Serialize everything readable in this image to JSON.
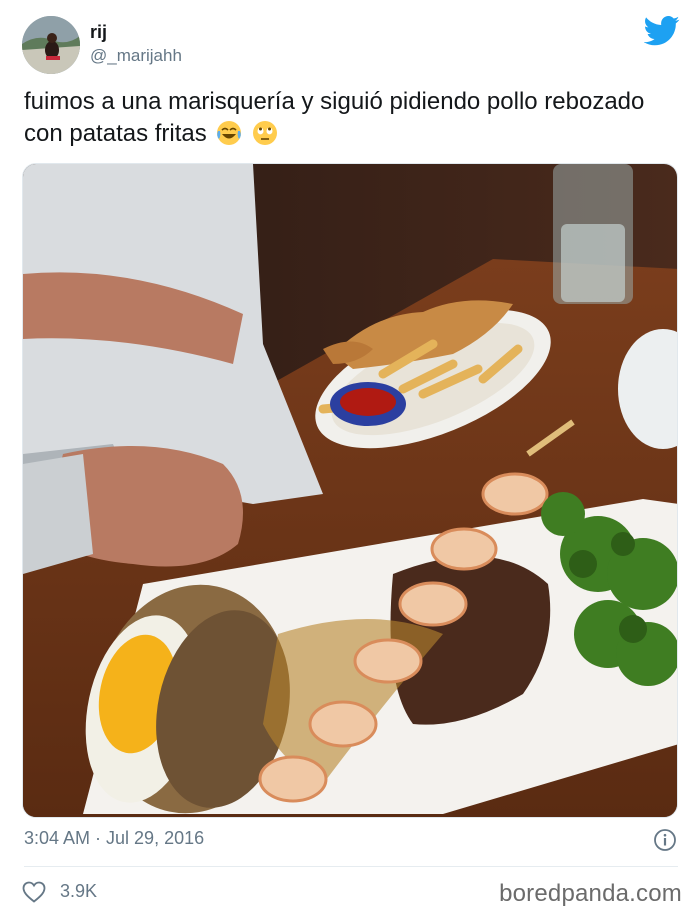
{
  "tweet": {
    "display_name": "rij",
    "handle": "@_marijahh",
    "text": "fuimos a una marisquería y siguió pidiendo pollo rebozado con patatas fritas",
    "emojis": [
      "face-with-tears-of-joy",
      "face-with-rolling-eyes"
    ],
    "timestamp": "3:04 AM · Jul 29, 2016",
    "like_count": "3.9K"
  },
  "icons": {
    "brand": "twitter-bird-icon",
    "info": "info-icon",
    "like": "heart-icon"
  },
  "colors": {
    "twitter_blue": "#1da1f2",
    "secondary_text": "#657786"
  },
  "watermark": "boredpanda.com"
}
